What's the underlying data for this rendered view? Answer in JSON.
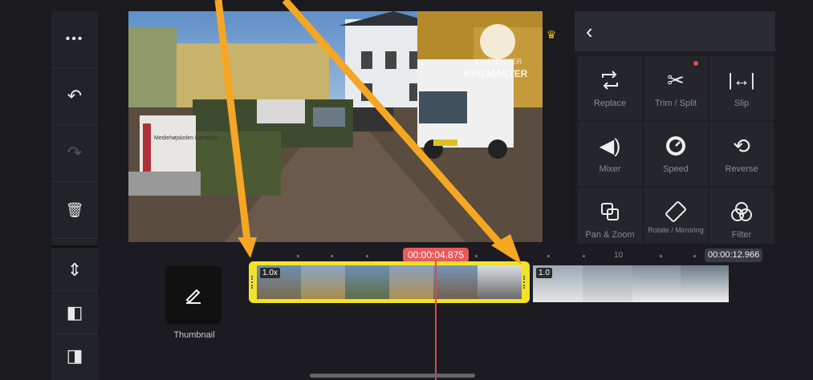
{
  "left_toolbar": {
    "items": [
      {
        "name": "more-icon",
        "glyph": "•••"
      },
      {
        "name": "undo-icon",
        "glyph": "↶"
      },
      {
        "name": "redo-icon",
        "glyph": "↷"
      },
      {
        "name": "delete-icon",
        "glyph": "🗑"
      },
      {
        "name": "track-height-icon",
        "glyph": "⇕"
      },
      {
        "name": "crop-start-icon",
        "glyph": "◧"
      },
      {
        "name": "crop-end-icon",
        "glyph": "◨"
      }
    ]
  },
  "preview": {
    "watermark_line1": "KINEMASTER",
    "watermark_line2": "KINEMASTER",
    "sign_text": "Mediehøjskolen Danmark"
  },
  "right_panel": {
    "back_glyph": "‹",
    "tools": [
      {
        "label": "Replace",
        "icon": "replace-icon"
      },
      {
        "label": "Trim / Split",
        "icon": "scissors-icon"
      },
      {
        "label": "Slip",
        "icon": "slip-icon"
      },
      {
        "label": "Mixer",
        "icon": "speaker-icon"
      },
      {
        "label": "Speed",
        "icon": "speedometer-icon"
      },
      {
        "label": "Reverse",
        "icon": "reverse-icon"
      },
      {
        "label": "Pan & Zoom",
        "icon": "pan-zoom-icon"
      },
      {
        "label": "Rotate / Mirroring",
        "icon": "rotate-icon"
      },
      {
        "label": "Filter",
        "icon": "filter-icon"
      }
    ]
  },
  "timeline": {
    "current_time": "00:00:04.875",
    "end_time": "00:00:12.966",
    "ruler_mark": "10",
    "thumbnail_label": "Thumbnail",
    "clip1_badge": "1.0x",
    "clip2_badge": "1.0"
  },
  "colors": {
    "accent_yellow": "#f2e22a",
    "playhead_red": "#e04848",
    "annotation_arrow": "#f5a623"
  }
}
